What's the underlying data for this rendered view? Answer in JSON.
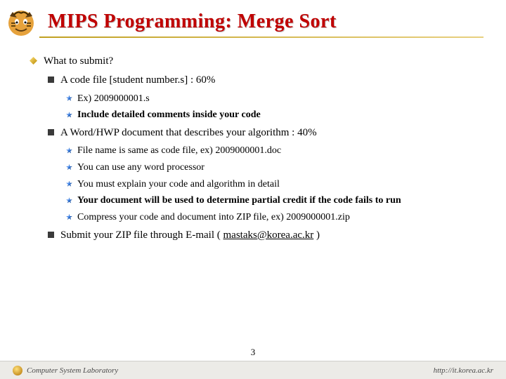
{
  "title": "MIPS Programming: Merge Sort",
  "bullets": {
    "l1a": "What to submit?",
    "l2a": "A code file [student number.s] : 60%",
    "l3a": "Ex) 2009000001.s",
    "l3b": "Include detailed comments inside your code",
    "l2b": "A Word/HWP document that describes your algorithm : 40%",
    "l3c": "File name is same as code file, ex) 2009000001.doc",
    "l3d": "You can use any word processor",
    "l3e": "You must explain your code and algorithm in detail",
    "l3f": "Your document will be used to determine partial credit if the code fails to run",
    "l3g": "Compress your code and document into ZIP file, ex) 2009000001.zip",
    "l2c_pre": "Submit your ZIP file through E-mail ( ",
    "l2c_link": "mastaks@korea.ac.kr",
    "l2c_post": " )"
  },
  "footer": {
    "lab": "Computer System Laboratory",
    "url": "http://it.korea.ac.kr"
  },
  "page_number": "3"
}
